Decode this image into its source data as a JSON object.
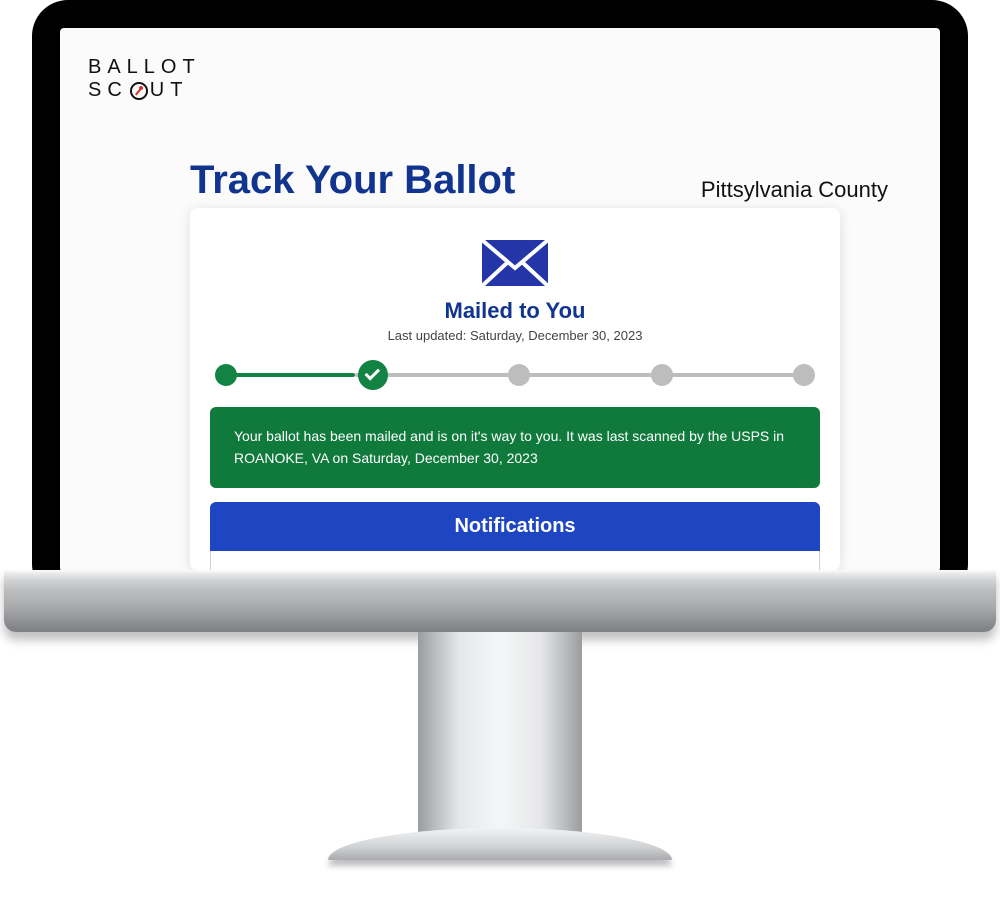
{
  "logo": {
    "line1": "BALLOT",
    "line2_prefix": "SC",
    "line2_suffix": "UT"
  },
  "header": {
    "title": "Track Your Ballot",
    "county": "Pittsylvania County"
  },
  "status": {
    "title": "Mailed to You",
    "last_updated": "Last updated: Saturday, December 30, 2023",
    "message": "Your ballot has been mailed and is on it's way to you. It was last scanned by the USPS in ROANOKE, VA on Saturday, December 30, 2023"
  },
  "progress": {
    "steps": [
      {
        "state": "done"
      },
      {
        "state": "current"
      },
      {
        "state": "pending"
      },
      {
        "state": "pending"
      },
      {
        "state": "pending"
      }
    ]
  },
  "notifications": {
    "header": "Notifications"
  }
}
